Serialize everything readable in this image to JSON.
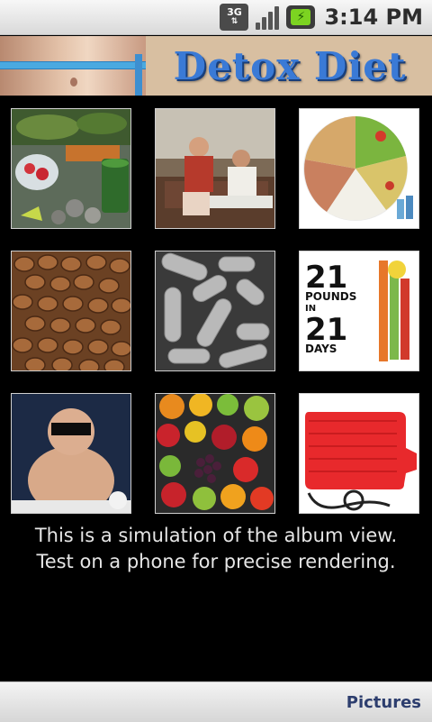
{
  "status_bar": {
    "network_label": "3G",
    "time": "3:14 PM",
    "icons": [
      "network-3g-icon",
      "signal-strength-icon",
      "battery-charging-icon"
    ]
  },
  "header": {
    "title": "Detox Diet",
    "title_color": "#3a7ad6"
  },
  "album": {
    "items": [
      {
        "name": "detox-drinks-photo"
      },
      {
        "name": "couch-people-photo"
      },
      {
        "name": "food-plate-photo"
      },
      {
        "name": "coffee-beans-photo"
      },
      {
        "name": "bacteria-micrograph-photo"
      },
      {
        "name": "book-cover-21-pounds-photo"
      },
      {
        "name": "child-photo"
      },
      {
        "name": "fruit-assortment-photo"
      },
      {
        "name": "hot-water-bottle-photo"
      }
    ],
    "book_cover": {
      "line1": "21",
      "line2": "POUNDS",
      "line3": "IN",
      "line4": "21",
      "line5": "DAYS"
    }
  },
  "caption": {
    "line1": "This is a simulation of the album view.",
    "line2": "Test on a phone for precise rendering."
  },
  "bottom_bar": {
    "pictures_label": "Pictures",
    "pictures_color": "#2d3e6e"
  }
}
